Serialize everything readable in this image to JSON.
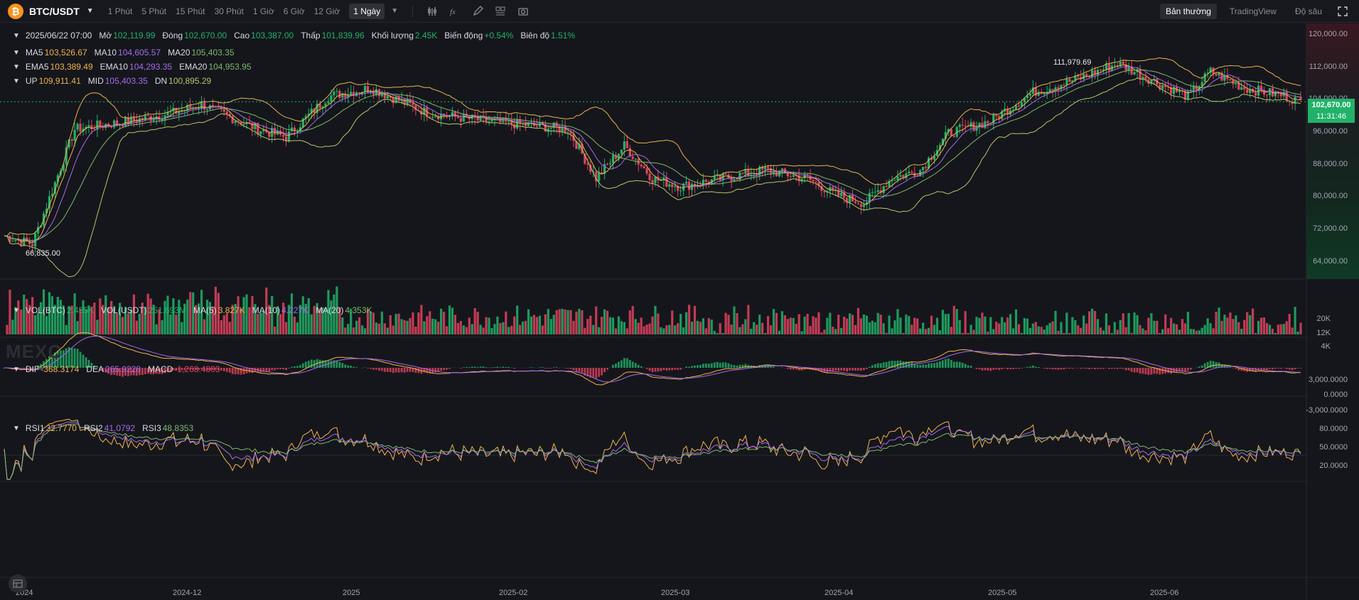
{
  "toolbar": {
    "pair": "BTC/USDT",
    "timeframes": [
      "1 Phút",
      "5 Phút",
      "15 Phút",
      "30 Phút",
      "1 Giờ",
      "6 Giờ",
      "12 Giờ",
      "1 Ngày"
    ],
    "active_timeframe": "1 Ngày",
    "tools": [
      "indicator-icon",
      "formula-icon",
      "draw-icon",
      "layout-icon",
      "camera-icon"
    ],
    "views": [
      "Bản thường",
      "TradingView",
      "Độ sâu"
    ],
    "active_view": "Bản thường"
  },
  "ohlc": {
    "date": "2025/06/22 07:00",
    "open_label": "Mở",
    "open": "102,119.99",
    "close_label": "Đóng",
    "close": "102,670.00",
    "high_label": "Cao",
    "high": "103,387.00",
    "low_label": "Thấp",
    "low": "101,839.96",
    "volume_label": "Khối lượng",
    "volume": "2.45K",
    "change_label": "Biến động",
    "change": "+0.54%",
    "amplitude_label": "Biên độ",
    "amplitude": "1.51%"
  },
  "ma": {
    "ma5": "103,526.67",
    "ma10": "104,605.57",
    "ma20": "105,403.35"
  },
  "ema": {
    "ema5": "103,389.49",
    "ema10": "104,293.35",
    "ema20": "104,953.95"
  },
  "boll": {
    "up": "109,911.41",
    "mid": "105,403.35",
    "dn": "100,895.29"
  },
  "vol": {
    "btc": "2.455K",
    "usdt": "251.693M",
    "ma5": "3.827K",
    "ma10": "4.227K",
    "ma20": "4.353K"
  },
  "macd": {
    "dif": "-368.3174",
    "dea": "265.9228",
    "macd": "-1,268.4803"
  },
  "rsi": {
    "rsi1": "32.7770",
    "rsi2": "41.0792",
    "rsi3": "48.8353"
  },
  "price_axis": [
    "120,000.00",
    "112,000.00",
    "104,000.00",
    "96,000.00",
    "88,000.00",
    "80,000.00",
    "72,000.00",
    "64,000.00"
  ],
  "vol_axis": [
    "20K",
    "12K",
    "4K"
  ],
  "macd_axis": [
    "3,000.0000",
    "0.0000",
    "-3,000.0000"
  ],
  "rsi_axis": [
    "80.0000",
    "50.0000",
    "20.0000"
  ],
  "time_axis": [
    "2024",
    "2024-12",
    "2025",
    "2025-02",
    "2025-03",
    "2025-04",
    "2025-05",
    "2025-06"
  ],
  "current_price": "102,670.00",
  "countdown": "11:31:46",
  "high_marker": "111,979.69",
  "low_marker": "66,835.00",
  "watermark": "MEXC",
  "colors": {
    "up": "#21b269",
    "down": "#e0435e",
    "ma5": "#f0b44c",
    "ma10": "#a46bea",
    "ma20": "#7cb96a",
    "boll_up": "#e7b34f",
    "boll_mid": "#a46bea",
    "boll_dn": "#b8c56a"
  }
}
